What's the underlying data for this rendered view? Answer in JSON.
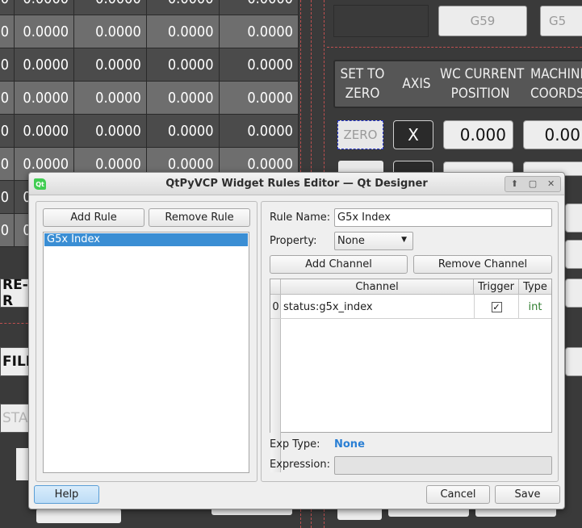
{
  "background": {
    "wc_value": "0.0000",
    "wc_rows": 8,
    "g_buttons": [
      "G59",
      "G5"
    ],
    "header": {
      "set_to_zero": "SET TO\nZERO",
      "axis": "AXIS",
      "wc_current_position": "WC CURRENT\nPOSITION",
      "machine_coords": "MACHINE\nCOORDS"
    },
    "zero_label": "ZERO",
    "axis_label": "X",
    "current_value": "0.000",
    "machine_value": "0.00",
    "side_buttons": {
      "re_run": "RE-R",
      "file": "FILE",
      "start": "STAR"
    }
  },
  "dialog": {
    "title": "QtPyVCP Widget Rules Editor — Qt Designer",
    "logo": "Qt",
    "window_buttons": [
      "up-arrow-icon",
      "restore-icon",
      "close-icon"
    ],
    "left_panel": {
      "add_rule": "Add Rule",
      "remove_rule": "Remove Rule",
      "rules": [
        "G5x Index"
      ]
    },
    "right_panel": {
      "rule_name_label": "Rule Name:",
      "rule_name_value": "G5x Index",
      "property_label": "Property:",
      "property_value": "None",
      "add_channel": "Add Channel",
      "remove_channel": "Remove Channel",
      "table": {
        "headers": [
          "Channel",
          "Trigger",
          "Type"
        ],
        "rows": [
          {
            "index": "0",
            "channel": "status:g5x_index",
            "trigger": "✓",
            "type": "int"
          }
        ]
      },
      "exp_type_label": "Exp Type:",
      "exp_type_value": "None",
      "expression_label": "Expression:",
      "expression_value": ""
    },
    "footer": {
      "help": "Help",
      "cancel": "Cancel",
      "save": "Save"
    },
    "colors": {
      "accent": "#3a8ed4",
      "link": "#2a7fd4",
      "type_green": "#2f7d2f"
    }
  }
}
